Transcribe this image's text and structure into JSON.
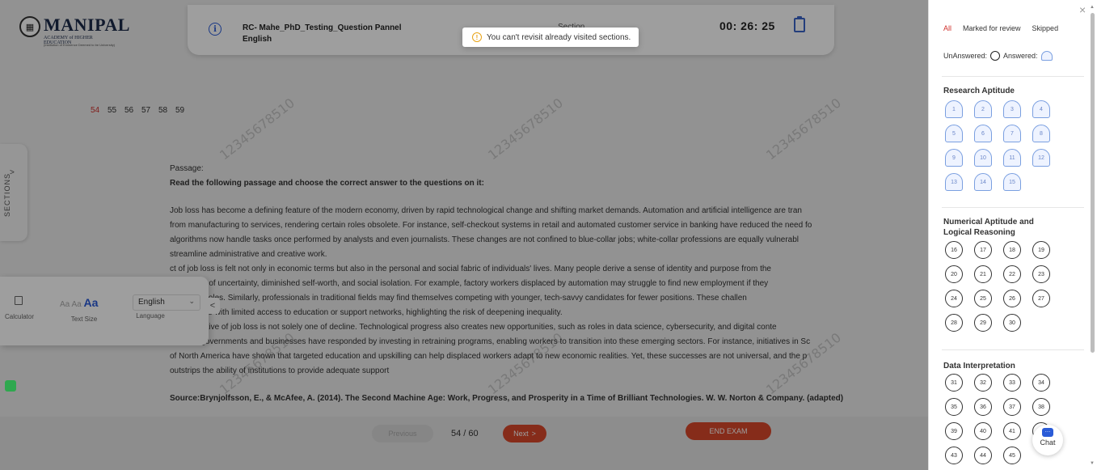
{
  "header": {
    "brand": "MANIPAL",
    "brand_sub": "ACADEMY of HIGHER EDUCATION",
    "brand_sub2": "(Institution of Eminence Deemed to be University)",
    "exam_title": "RC- Mahe_PhD_Testing_Question Pannel",
    "language": "English",
    "section_label": "Section",
    "timer": "00: 26: 25"
  },
  "toast": {
    "message": "You can't revisit already visited sections."
  },
  "question_numbers": [
    {
      "label": "54",
      "active": true
    },
    {
      "label": "55",
      "active": false
    },
    {
      "label": "56",
      "active": false
    },
    {
      "label": "57",
      "active": false
    },
    {
      "label": "58",
      "active": false
    },
    {
      "label": "59",
      "active": false
    }
  ],
  "watermark": "12345678510",
  "sections_tab": {
    "label": "SECTIONS",
    "chevron": ">"
  },
  "passage": {
    "label": "Passage:",
    "instruction": "Read the following passage and choose the correct answer to the questions on it:",
    "paragraph1": [
      "Job loss has become a defining feature of the modern economy, driven by rapid technological change and shifting market demands. Automation and artificial intelligence are tran",
      "from manufacturing to services, rendering certain roles obsolete. For instance, self-checkout systems in retail and automated customer service in banking have reduced the need fo",
      "algorithms now handle tasks once performed by analysts and even journalists. These changes are not confined to blue-collar jobs; white-collar professions are equally vulnerabl",
      "streamline administrative and creative work."
    ],
    "paragraph2": [
      "ct of job loss is felt not only in economic terms but also in the personal and social fabric of individuals' lives. Many people derive a sense of identity and purpose from the",
      "to feelings of uncertainty, diminished self-worth, and social isolation. For example, factory workers displaced by automation may struggle to find new employment if they",
      "emerging roles. Similarly, professionals in traditional fields may find themselves competing with younger, tech-savvy candidates for fewer positions. These challen",
      "ed for those with limited access to education or support networks, highlighting the risk of deepening inequality."
    ],
    "paragraph3": [
      ", the narrative of job loss is not solely one of decline. Technological progress also creates new opportunities, such as roles in data science, cybersecurity, and digital conte",
      "regions, governments and businesses have responded by investing in retraining programs, enabling workers to transition into these emerging sectors. For instance, initiatives in Sc",
      "of North America have shown that targeted education and upskilling can help displaced workers adapt to new economic realities. Yet, these successes are not universal, and the p",
      "outstrips the ability of institutions to provide adequate support"
    ],
    "source": "Source:Brynjolfsson, E., & McAfee, A. (2014). The Second Machine Age: Work, Progress, and Prosperity in a Time of Brilliant Technologies. W. W. Norton & Company. (adapted)"
  },
  "tools": {
    "calculator_label": "Calculator",
    "text_size_label": "Text Size",
    "text_size_options": [
      "Aa",
      "Aa",
      "Aa"
    ],
    "language_label": "Language",
    "language_value": "English",
    "collapse_chevron": "<"
  },
  "footer": {
    "previous_label": "Previous",
    "counter": "54 / 60",
    "next_label": "Next",
    "next_arrow": ">",
    "end_exam_label": "END EXAM"
  },
  "palette": {
    "tabs": [
      {
        "label": "All",
        "active": true
      },
      {
        "label": "Marked for review",
        "active": false
      },
      {
        "label": "Skipped",
        "active": false
      }
    ],
    "unanswered_label": "UnAnswered:",
    "answered_label": "Answered:",
    "sections": [
      {
        "title": [
          "Research Aptitude"
        ],
        "style": "shield",
        "questions": [
          "1",
          "2",
          "3",
          "4",
          "5",
          "6",
          "7",
          "8",
          "9",
          "10",
          "11",
          "12",
          "13",
          "14",
          "15"
        ]
      },
      {
        "title": [
          "Numerical Aptitude and",
          "Logical Reasoning"
        ],
        "style": "circle",
        "questions": [
          "16",
          "17",
          "18",
          "19",
          "20",
          "21",
          "22",
          "23",
          "24",
          "25",
          "26",
          "27",
          "28",
          "29",
          "30"
        ]
      },
      {
        "title": [
          "Data Interpretation"
        ],
        "style": "circle",
        "questions": [
          "31",
          "32",
          "33",
          "34",
          "35",
          "36",
          "37",
          "38",
          "39",
          "40",
          "41",
          "42",
          "43",
          "44",
          "45"
        ]
      }
    ],
    "chat_label": "Chat",
    "close_symbol": "×"
  },
  "colors": {
    "accent_red": "#d8472b",
    "active_red": "#d0312d",
    "brand_blue": "#2a5bd7",
    "answered_blue": "#7a9fe0"
  }
}
